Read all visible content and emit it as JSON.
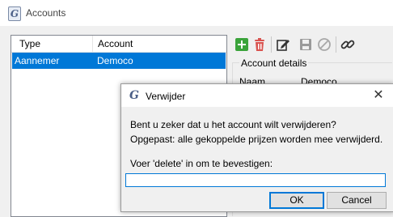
{
  "window": {
    "title": "Accounts",
    "app_icon_letter": "G"
  },
  "list": {
    "headers": [
      "Type",
      "Account"
    ],
    "rows": [
      {
        "type": "Aannemer",
        "account": "Democo"
      }
    ]
  },
  "toolbar": {
    "icons": [
      "add-icon",
      "delete-icon",
      "edit-icon",
      "save-icon",
      "cancel-icon",
      "link-icon"
    ]
  },
  "details": {
    "group_title": "Account details",
    "name_label": "Naam",
    "name_value": "Democo"
  },
  "dialog": {
    "title": "Verwijder",
    "icon_letter": "G",
    "close_glyph": "✕",
    "line1": "Bent u zeker dat u het account wilt verwijderen?",
    "line2": "Opgepast: alle gekoppelde prijzen worden mee verwijderd.",
    "prompt": "Voer 'delete' in om te bevestigen:",
    "input_value": "",
    "ok": "OK",
    "cancel": "Cancel"
  },
  "colors": {
    "selection": "#0078d7",
    "add": "#3aa33a",
    "delete": "#d9534f"
  }
}
